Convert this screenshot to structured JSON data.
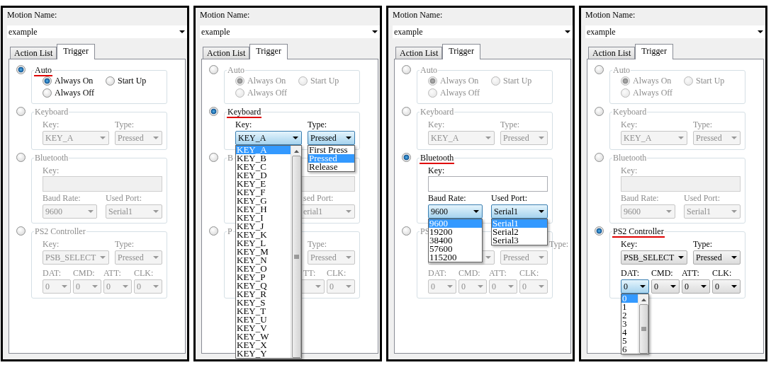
{
  "panels": [
    {
      "motion_name_label": "Motion Name:",
      "motion_name": "example",
      "tabs": [
        {
          "label": "Action List",
          "selected": false
        },
        {
          "label": "Trigger",
          "selected": true
        }
      ],
      "groups": [
        {
          "kind": "auto",
          "title": "Auto",
          "selected": true,
          "options": [
            {
              "label": "Always On",
              "checked": true
            },
            {
              "label": "Start Up",
              "checked": false
            },
            {
              "label": "Always Off",
              "checked": false
            }
          ]
        },
        {
          "kind": "keyboard",
          "title": "Keyboard",
          "selected": false,
          "fields": [
            {
              "kind": "select",
              "label": "Key:",
              "value": "KEY_A"
            },
            {
              "kind": "select",
              "label": "Type:",
              "value": "Pressed"
            }
          ]
        },
        {
          "kind": "bluetooth",
          "title": "Bluetooth",
          "selected": false,
          "key_field": {
            "kind": "entry",
            "label": "Key:"
          },
          "fields": [
            {
              "kind": "select",
              "label": "Baud Rate:",
              "value": "9600"
            },
            {
              "kind": "select",
              "label": "Used Port:",
              "value": "Serial1"
            }
          ]
        },
        {
          "kind": "ps2",
          "title": "PS2 Controller",
          "selected": false,
          "fields": [
            {
              "kind": "select",
              "label": "Key:",
              "value": "PSB_SELECT"
            },
            {
              "kind": "select",
              "label": "Type:",
              "value": "Pressed"
            }
          ],
          "pins": [
            {
              "kind": "select",
              "label": "DAT:",
              "value": "0"
            },
            {
              "kind": "select",
              "label": "CMD:",
              "value": "0"
            },
            {
              "kind": "select",
              "label": "ATT:",
              "value": "0"
            },
            {
              "kind": "select",
              "label": "CLK:",
              "value": "0"
            }
          ]
        }
      ]
    },
    {
      "motion_name_label": "Motion Name:",
      "motion_name": "example",
      "tabs": [
        {
          "label": "Action List",
          "selected": false
        },
        {
          "label": "Trigger",
          "selected": true
        }
      ],
      "groups": [
        {
          "kind": "auto",
          "title": "Auto",
          "selected": false,
          "options": [
            {
              "label": "Always On",
              "checked": true
            },
            {
              "label": "Start Up",
              "checked": false
            },
            {
              "label": "Always Off",
              "checked": false
            }
          ]
        },
        {
          "kind": "keyboard",
          "title": "Keyboard",
          "selected": true,
          "fields": [
            {
              "kind": "select",
              "label": "Key:",
              "value": "KEY_A",
              "list": {
                "scrollbar": true,
                "items": [
                  {
                    "label": "KEY_A",
                    "selected": true
                  },
                  {
                    "label": "KEY_B",
                    "selected": false
                  },
                  {
                    "label": "KEY_C",
                    "selected": false
                  },
                  {
                    "label": "KEY_D",
                    "selected": false
                  },
                  {
                    "label": "KEY_E",
                    "selected": false
                  },
                  {
                    "label": "KEY_F",
                    "selected": false
                  },
                  {
                    "label": "KEY_G",
                    "selected": false
                  },
                  {
                    "label": "KEY_H",
                    "selected": false
                  },
                  {
                    "label": "KEY_I",
                    "selected": false
                  },
                  {
                    "label": "KEY_J",
                    "selected": false
                  },
                  {
                    "label": "KEY_K",
                    "selected": false
                  },
                  {
                    "label": "KEY_L",
                    "selected": false
                  },
                  {
                    "label": "KEY_M",
                    "selected": false
                  },
                  {
                    "label": "KEY_N",
                    "selected": false
                  },
                  {
                    "label": "KEY_O",
                    "selected": false
                  },
                  {
                    "label": "KEY_P",
                    "selected": false
                  },
                  {
                    "label": "KEY_Q",
                    "selected": false
                  },
                  {
                    "label": "KEY_R",
                    "selected": false
                  },
                  {
                    "label": "KEY_S",
                    "selected": false
                  },
                  {
                    "label": "KEY_T",
                    "selected": false
                  },
                  {
                    "label": "KEY_U",
                    "selected": false
                  },
                  {
                    "label": "KEY_V",
                    "selected": false
                  },
                  {
                    "label": "KEY_W",
                    "selected": false
                  },
                  {
                    "label": "KEY_X",
                    "selected": false
                  },
                  {
                    "label": "KEY_Y",
                    "selected": false
                  }
                ]
              }
            },
            {
              "kind": "select",
              "label": "Type:",
              "value": "Pressed",
              "list": {
                "scrollbar": false,
                "items": [
                  {
                    "label": "First Press",
                    "selected": false
                  },
                  {
                    "label": "Pressed",
                    "selected": true
                  },
                  {
                    "label": "Release",
                    "selected": false
                  }
                ]
              }
            }
          ]
        },
        {
          "kind": "bluetooth",
          "title": "B",
          "selected": false,
          "key_field": {
            "kind": "entry"
          },
          "fields": [
            {
              "kind": "none"
            },
            {
              "kind": "select",
              "label": "sed Port:",
              "value": "erial1"
            }
          ]
        },
        {
          "kind": "ps2",
          "title": "P",
          "selected": false,
          "fields": [
            {
              "kind": "none"
            },
            {
              "kind": "select",
              "label": "Type:",
              "value": "Pressed"
            }
          ],
          "pins": [
            {
              "kind": "none"
            },
            {
              "kind": "none"
            },
            {
              "kind": "select",
              "label": "TT:"
            },
            {
              "kind": "select",
              "label": "CLK:",
              "value": "0"
            }
          ]
        }
      ]
    },
    {
      "motion_name_label": "Motion Name:",
      "motion_name": "example",
      "tabs": [
        {
          "label": "Action List",
          "selected": false
        },
        {
          "label": "Trigger",
          "selected": true
        }
      ],
      "groups": [
        {
          "kind": "auto",
          "title": "Auto",
          "selected": false,
          "options": [
            {
              "label": "Always On",
              "checked": true
            },
            {
              "label": "Start Up",
              "checked": false
            },
            {
              "label": "Always Off",
              "checked": false
            }
          ]
        },
        {
          "kind": "keyboard",
          "title": "Keyboard",
          "selected": false,
          "fields": [
            {
              "kind": "select",
              "label": "Key:",
              "value": "KEY_A"
            },
            {
              "kind": "select",
              "label": "Type:",
              "value": "Pressed"
            }
          ]
        },
        {
          "kind": "bluetooth",
          "title": "Bluetooth",
          "selected": true,
          "key_field": {
            "kind": "entry",
            "label": "Key:"
          },
          "fields": [
            {
              "kind": "select",
              "label": "Baud Rate:",
              "value": "9600",
              "list": {
                "scrollbar": false,
                "items": [
                  {
                    "label": "9600",
                    "selected": true
                  },
                  {
                    "label": "19200",
                    "selected": false
                  },
                  {
                    "label": "38400",
                    "selected": false
                  },
                  {
                    "label": "57600",
                    "selected": false
                  },
                  {
                    "label": "115200",
                    "selected": false
                  }
                ]
              }
            },
            {
              "kind": "select",
              "label": "Used Port:",
              "value": "Serial1",
              "list": {
                "scrollbar": false,
                "items": [
                  {
                    "label": "Serial1",
                    "selected": true
                  },
                  {
                    "label": "Serial2",
                    "selected": false
                  },
                  {
                    "label": "Serial3",
                    "selected": false
                  }
                ]
              }
            }
          ]
        },
        {
          "kind": "ps2",
          "title": "PS",
          "selected": false,
          "fields": [
            {
              "kind": "select"
            },
            {
              "kind": "select",
              "label": "Type:",
              "value": "Pressed"
            }
          ],
          "pins": [
            {
              "kind": "select",
              "label": "DAT:",
              "value": "0"
            },
            {
              "kind": "select",
              "label": "CMD:",
              "value": "0"
            },
            {
              "kind": "select",
              "label": "ATT:",
              "value": "0"
            },
            {
              "kind": "select",
              "label": "CLK:",
              "value": "0"
            }
          ]
        }
      ]
    },
    {
      "motion_name_label": "Motion Name:",
      "motion_name": "example",
      "tabs": [
        {
          "label": "Action List",
          "selected": false
        },
        {
          "label": "Trigger",
          "selected": true
        }
      ],
      "groups": [
        {
          "kind": "auto",
          "title": "Auto",
          "selected": false,
          "options": [
            {
              "label": "Always On",
              "checked": true
            },
            {
              "label": "Start Up",
              "checked": false
            },
            {
              "label": "Always Off",
              "checked": false
            }
          ]
        },
        {
          "kind": "keyboard",
          "title": "Keyboard",
          "selected": false,
          "fields": [
            {
              "kind": "select",
              "label": "Key:",
              "value": "KEY_A"
            },
            {
              "kind": "select",
              "label": "Type:",
              "value": "Pressed"
            }
          ]
        },
        {
          "kind": "bluetooth",
          "title": "Bluetooth",
          "selected": false,
          "key_field": {
            "kind": "entry",
            "label": "Key:"
          },
          "fields": [
            {
              "kind": "select",
              "label": "Baud Rate:",
              "value": "9600"
            },
            {
              "kind": "select",
              "label": "Used Port:",
              "value": "Serial1"
            }
          ]
        },
        {
          "kind": "ps2",
          "title": "PS2 Controller",
          "selected": true,
          "fields": [
            {
              "kind": "select",
              "label": "Key:",
              "value": "PSB_SELECT"
            },
            {
              "kind": "select",
              "label": "Type:",
              "value": "Pressed"
            }
          ],
          "pins": [
            {
              "kind": "select",
              "label": "DAT:",
              "value": "0",
              "list": {
                "scrollbar": true,
                "items": [
                  {
                    "label": "0",
                    "selected": true
                  },
                  {
                    "label": "1",
                    "selected": false
                  },
                  {
                    "label": "2",
                    "selected": false
                  },
                  {
                    "label": "3",
                    "selected": false
                  },
                  {
                    "label": "4",
                    "selected": false
                  },
                  {
                    "label": "5",
                    "selected": false
                  },
                  {
                    "label": "6",
                    "selected": false
                  }
                ]
              }
            },
            {
              "kind": "select",
              "label": "CMD:",
              "value": "0"
            },
            {
              "kind": "select",
              "label": "ATT:",
              "value": "0"
            },
            {
              "kind": "select",
              "label": "CLK:",
              "value": "0"
            }
          ]
        }
      ]
    }
  ]
}
